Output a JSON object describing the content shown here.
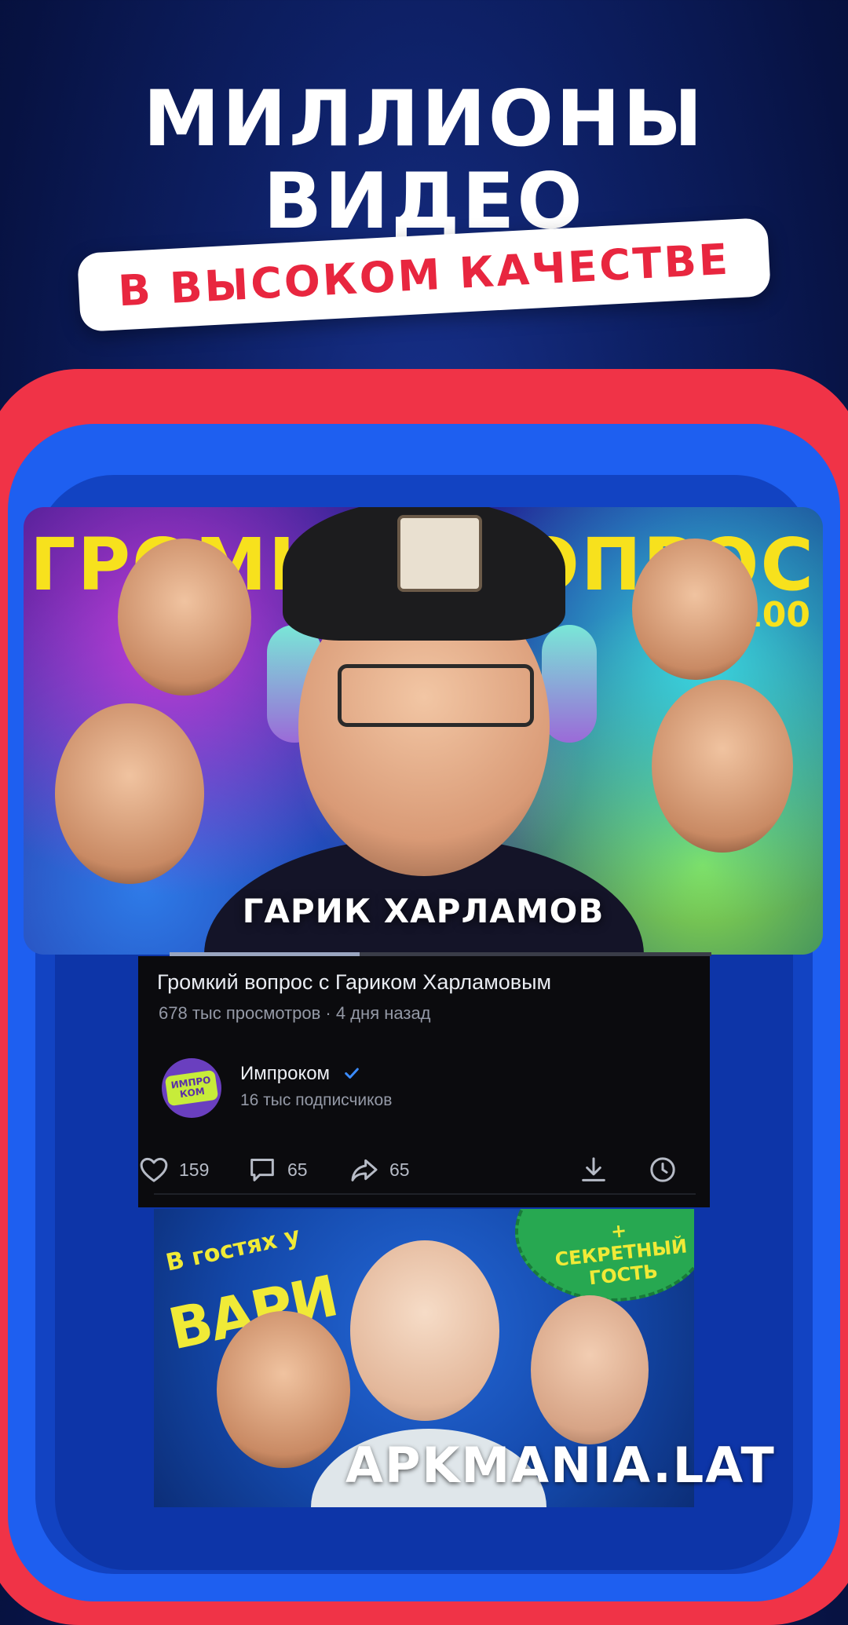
{
  "header": {
    "line1": "МИЛЛИОНЫ",
    "line2": "ВИДЕО",
    "pill": "В ВЫСОКОМ КАЧЕСТВЕ"
  },
  "hero": {
    "top_text_left": "ГРОМК",
    "top_text_right": "ОПРОС",
    "tag": "№100",
    "name_overlay": "ГАРИК ХАРЛАМОВ",
    "progress": 0.35
  },
  "video": {
    "title": "Громкий вопрос с Гариком Харламовым",
    "meta": "678 тыс просмотров · 4 дня назад",
    "channel": {
      "name": "Импроком",
      "subscribers": "16 тыс подписчиков",
      "logo_line1": "ИМПРО",
      "logo_line2": "КОМ"
    },
    "actions": {
      "likes": "159",
      "comments": "65",
      "shares": "65"
    }
  },
  "next_thumb": {
    "small_text": "В гостях у",
    "big_text": "ВАРИ",
    "badge_text": "+ СЕКРЕТНЫЙ ГОСТЬ"
  },
  "watermark": "APKMANIA.LAT",
  "colors": {
    "accent_red": "#e8263f",
    "frame_red": "#f03347",
    "frame_blue": "#1e5ff0",
    "verified_blue": "#3b8cff"
  }
}
